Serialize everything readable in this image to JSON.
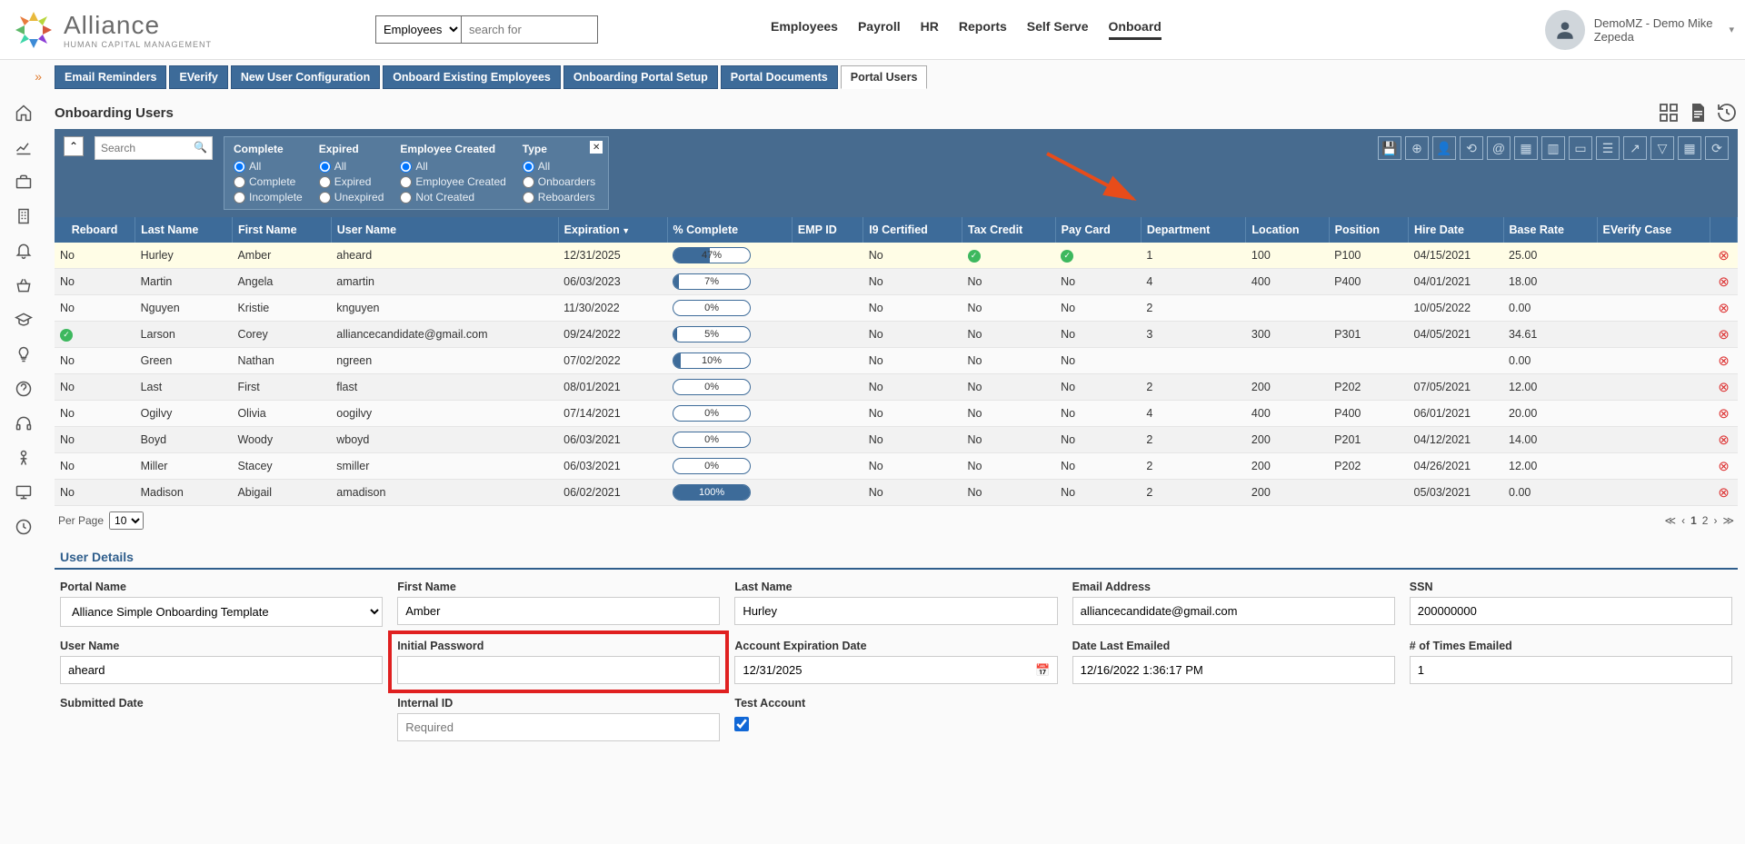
{
  "logo": {
    "title": "Alliance",
    "sub": "HUMAN CAPITAL MANAGEMENT"
  },
  "topSearch": {
    "select": "Employees",
    "placeholder": "search for"
  },
  "topNav": [
    "Employees",
    "Payroll",
    "HR",
    "Reports",
    "Self Serve",
    "Onboard"
  ],
  "topNavActive": "Onboard",
  "user": {
    "label1": "DemoMZ - Demo Mike",
    "label2": "Zepeda"
  },
  "tabs": [
    "Email Reminders",
    "EVerify",
    "New User Configuration",
    "Onboard Existing Employees",
    "Onboarding Portal Setup",
    "Portal Documents",
    "Portal Users"
  ],
  "activeTab": "Portal Users",
  "pageTitle": "Onboarding Users",
  "filterSearchPlaceholder": "Search",
  "filters": {
    "complete": {
      "header": "Complete",
      "opts": [
        "All",
        "Complete",
        "Incomplete"
      ],
      "sel": "All"
    },
    "expired": {
      "header": "Expired",
      "opts": [
        "All",
        "Expired",
        "Unexpired"
      ],
      "sel": "All"
    },
    "empCreated": {
      "header": "Employee Created",
      "opts": [
        "All",
        "Employee Created",
        "Not Created"
      ],
      "sel": "All"
    },
    "type": {
      "header": "Type",
      "opts": [
        "All",
        "Onboarders",
        "Reboarders"
      ],
      "sel": "All"
    }
  },
  "columns": [
    "Reboard",
    "Last Name",
    "First Name",
    "User Name",
    "Expiration",
    "% Complete",
    "EMP ID",
    "I9 Certified",
    "Tax Credit",
    "Pay Card",
    "Department",
    "Location",
    "Position",
    "Hire Date",
    "Base Rate",
    "EVerify Case",
    ""
  ],
  "sortedCol": "Expiration",
  "rows": [
    {
      "reboard": "No",
      "last": "Hurley",
      "first": "Amber",
      "user": "aheard",
      "exp": "12/31/2025",
      "pct": 47,
      "emp": "",
      "i9": "No",
      "tax": "check",
      "pay": "check",
      "dept": "1",
      "loc": "100",
      "pos": "P100",
      "hire": "04/15/2021",
      "rate": "25.00",
      "ev": "",
      "sel": true
    },
    {
      "reboard": "No",
      "last": "Martin",
      "first": "Angela",
      "user": "amartin",
      "exp": "06/03/2023",
      "pct": 7,
      "emp": "",
      "i9": "No",
      "tax": "No",
      "pay": "No",
      "dept": "4",
      "loc": "400",
      "pos": "P400",
      "hire": "04/01/2021",
      "rate": "18.00",
      "ev": ""
    },
    {
      "reboard": "No",
      "last": "Nguyen",
      "first": "Kristie",
      "user": "knguyen",
      "exp": "11/30/2022",
      "pct": 0,
      "emp": "",
      "i9": "No",
      "tax": "No",
      "pay": "No",
      "dept": "2",
      "loc": "",
      "pos": "",
      "hire": "10/05/2022",
      "rate": "0.00",
      "ev": ""
    },
    {
      "reboard": "check",
      "last": "Larson",
      "first": "Corey",
      "user": "alliancecandidate@gmail.com",
      "exp": "09/24/2022",
      "pct": 5,
      "emp": "",
      "i9": "No",
      "tax": "No",
      "pay": "No",
      "dept": "3",
      "loc": "300",
      "pos": "P301",
      "hire": "04/05/2021",
      "rate": "34.61",
      "ev": ""
    },
    {
      "reboard": "No",
      "last": "Green",
      "first": "Nathan",
      "user": "ngreen",
      "exp": "07/02/2022",
      "pct": 10,
      "emp": "",
      "i9": "No",
      "tax": "No",
      "pay": "No",
      "dept": "",
      "loc": "",
      "pos": "",
      "hire": "",
      "rate": "0.00",
      "ev": ""
    },
    {
      "reboard": "No",
      "last": "Last",
      "first": "First",
      "user": "flast",
      "exp": "08/01/2021",
      "pct": 0,
      "emp": "",
      "i9": "No",
      "tax": "No",
      "pay": "No",
      "dept": "2",
      "loc": "200",
      "pos": "P202",
      "hire": "07/05/2021",
      "rate": "12.00",
      "ev": ""
    },
    {
      "reboard": "No",
      "last": "Ogilvy",
      "first": "Olivia",
      "user": "oogilvy",
      "exp": "07/14/2021",
      "pct": 0,
      "emp": "",
      "i9": "No",
      "tax": "No",
      "pay": "No",
      "dept": "4",
      "loc": "400",
      "pos": "P400",
      "hire": "06/01/2021",
      "rate": "20.00",
      "ev": ""
    },
    {
      "reboard": "No",
      "last": "Boyd",
      "first": "Woody",
      "user": "wboyd",
      "exp": "06/03/2021",
      "pct": 0,
      "emp": "",
      "i9": "No",
      "tax": "No",
      "pay": "No",
      "dept": "2",
      "loc": "200",
      "pos": "P201",
      "hire": "04/12/2021",
      "rate": "14.00",
      "ev": ""
    },
    {
      "reboard": "No",
      "last": "Miller",
      "first": "Stacey",
      "user": "smiller",
      "exp": "06/03/2021",
      "pct": 0,
      "emp": "",
      "i9": "No",
      "tax": "No",
      "pay": "No",
      "dept": "2",
      "loc": "200",
      "pos": "P202",
      "hire": "04/26/2021",
      "rate": "12.00",
      "ev": ""
    },
    {
      "reboard": "No",
      "last": "Madison",
      "first": "Abigail",
      "user": "amadison",
      "exp": "06/02/2021",
      "pct": 100,
      "emp": "",
      "i9": "No",
      "tax": "No",
      "pay": "No",
      "dept": "2",
      "loc": "200",
      "pos": "",
      "hire": "05/03/2021",
      "rate": "0.00",
      "ev": ""
    }
  ],
  "pager": {
    "perPageLabel": "Per Page",
    "perPage": "10",
    "current": "1",
    "next": "2"
  },
  "details": {
    "title": "User Details",
    "portalName": {
      "label": "Portal Name",
      "value": "Alliance Simple Onboarding Template"
    },
    "firstName": {
      "label": "First Name",
      "value": "Amber"
    },
    "lastName": {
      "label": "Last Name",
      "value": "Hurley"
    },
    "email": {
      "label": "Email Address",
      "value": "alliancecandidate@gmail.com"
    },
    "ssn": {
      "label": "SSN",
      "value": "200000000"
    },
    "userName": {
      "label": "User Name",
      "value": "aheard"
    },
    "initPwd": {
      "label": "Initial Password",
      "value": ""
    },
    "acctExp": {
      "label": "Account Expiration Date",
      "value": "12/31/2025"
    },
    "lastEmailed": {
      "label": "Date Last Emailed",
      "value": "12/16/2022 1:36:17 PM"
    },
    "timesEmailed": {
      "label": "# of Times Emailed",
      "value": "1"
    },
    "submitted": {
      "label": "Submitted Date",
      "value": ""
    },
    "internalId": {
      "label": "Internal ID",
      "placeholder": "Required"
    },
    "testAcct": {
      "label": "Test Account",
      "checked": true
    }
  }
}
